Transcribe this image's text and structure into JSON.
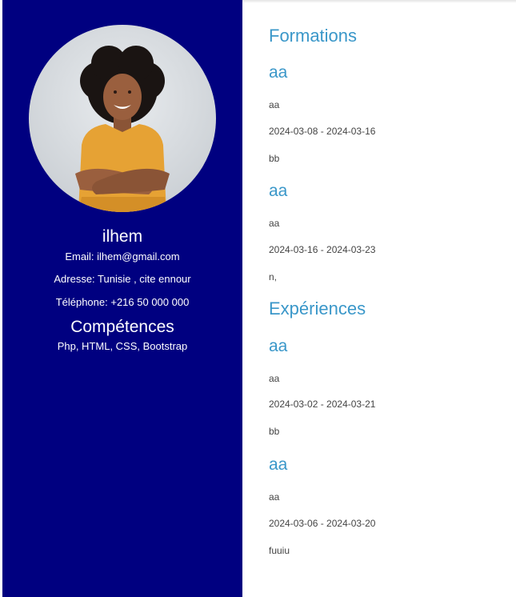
{
  "profile": {
    "name": "ilhem",
    "email": "Email: ilhem@gmail.com",
    "address": "Adresse: Tunisie , cite ennour",
    "phone": "Téléphone: +216 50 000 000",
    "skills_title": "Compétences",
    "skills": "Php, HTML, CSS, Bootstrap"
  },
  "formations": {
    "title": "Formations",
    "items": [
      {
        "title": "aa",
        "subtitle": "aa",
        "dates": "2024-03-08 - 2024-03-16",
        "description": "bb"
      },
      {
        "title": "aa",
        "subtitle": "aa",
        "dates": "2024-03-16 - 2024-03-23",
        "description": "n,"
      }
    ]
  },
  "experiences": {
    "title": "Expériences",
    "items": [
      {
        "title": "aa",
        "subtitle": "aa",
        "dates": "2024-03-02 - 2024-03-21",
        "description": "bb"
      },
      {
        "title": "aa",
        "subtitle": "aa",
        "dates": "2024-03-06 - 2024-03-20",
        "description": "fuuiu"
      }
    ]
  },
  "colors": {
    "sidebar": "#000080",
    "heading": "#3a97c9",
    "body_text": "#444444"
  },
  "icons": [
    "profile-photo"
  ]
}
